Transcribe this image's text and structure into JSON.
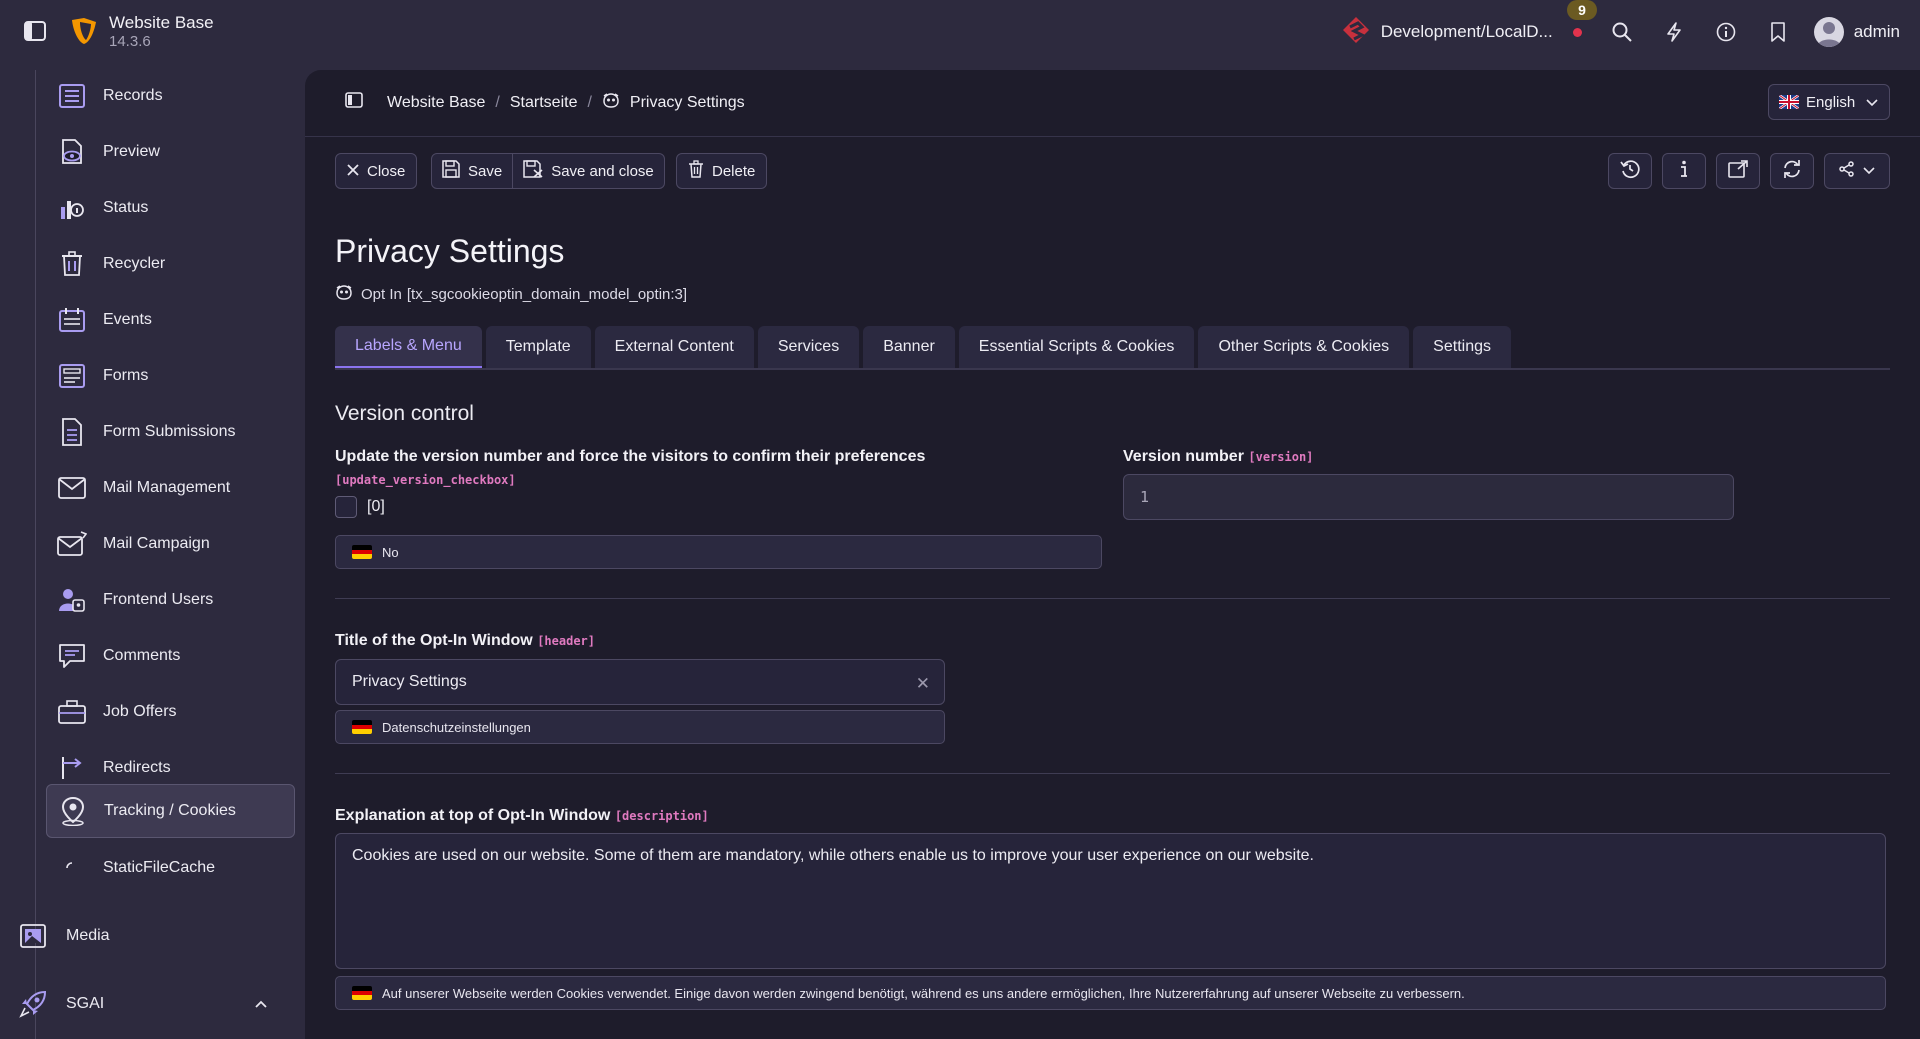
{
  "app": {
    "site_name": "Website Base",
    "version": "14.3.6",
    "environment": "Development/LocalD...",
    "notification_count": "9",
    "username": "admin"
  },
  "sidebar": {
    "items": [
      {
        "label": "Records",
        "icon": "records-icon"
      },
      {
        "label": "Preview",
        "icon": "preview-icon"
      },
      {
        "label": "Status",
        "icon": "status-icon"
      },
      {
        "label": "Recycler",
        "icon": "recycler-icon"
      },
      {
        "label": "Events",
        "icon": "events-icon"
      },
      {
        "label": "Forms",
        "icon": "forms-icon"
      },
      {
        "label": "Form Submissions",
        "icon": "form-submissions-icon"
      },
      {
        "label": "Mail Management",
        "icon": "mail-icon"
      },
      {
        "label": "Mail Campaign",
        "icon": "mail-campaign-icon"
      },
      {
        "label": "Frontend Users",
        "icon": "users-icon"
      },
      {
        "label": "Comments",
        "icon": "comments-icon"
      },
      {
        "label": "Job Offers",
        "icon": "briefcase-icon"
      },
      {
        "label": "Redirects",
        "icon": "redirect-icon"
      },
      {
        "label": "Tracking / Cookies",
        "icon": "location-pin-icon",
        "active": true
      },
      {
        "label": "StaticFileCache",
        "icon": "spinner-icon"
      }
    ],
    "media_label": "Media",
    "sgai_label": "SGAI"
  },
  "breadcrumb": {
    "items": [
      "Website Base",
      "Startseite",
      "Privacy Settings"
    ]
  },
  "language": {
    "selected": "English"
  },
  "toolbar": {
    "close_label": "Close",
    "save_label": "Save",
    "save_close_label": "Save and close",
    "delete_label": "Delete"
  },
  "page": {
    "title": "Privacy Settings",
    "record_type": "Opt In",
    "record_id": "[tx_sgcookieoptin_domain_model_optin:3]"
  },
  "tabs": [
    "Labels & Menu",
    "Template",
    "External Content",
    "Services",
    "Banner",
    "Essential Scripts & Cookies",
    "Other Scripts & Cookies",
    "Settings"
  ],
  "form": {
    "section_title": "Version control",
    "update_version": {
      "label": "Update the version number and force the visitors to confirm their preferences",
      "key": "[update_version_checkbox]",
      "checkbox_value": "[0]",
      "translation": "No"
    },
    "version_number": {
      "label": "Version number",
      "key": "[version]",
      "value": "1"
    },
    "header": {
      "label": "Title of the Opt-In Window",
      "key": "[header]",
      "value": "Privacy Settings",
      "translation": "Datenschutzeinstellungen"
    },
    "description": {
      "label": "Explanation at top of Opt-In Window",
      "key": "[description]",
      "value": "Cookies are used on our website. Some of them are mandatory, while others enable us to improve your user experience on our website.",
      "translation": "Auf unserer Webseite werden Cookies verwendet. Einige davon werden zwingend benötigt, während es uns andere ermöglichen, Ihre Nutzererfahrung auf unserer Webseite zu verbessern."
    }
  },
  "colors": {
    "accent": "#8b74ef",
    "field_key": "#e07ac0",
    "sidebar_bg": "#2d2a3e",
    "content_bg": "#1e1c2b"
  }
}
